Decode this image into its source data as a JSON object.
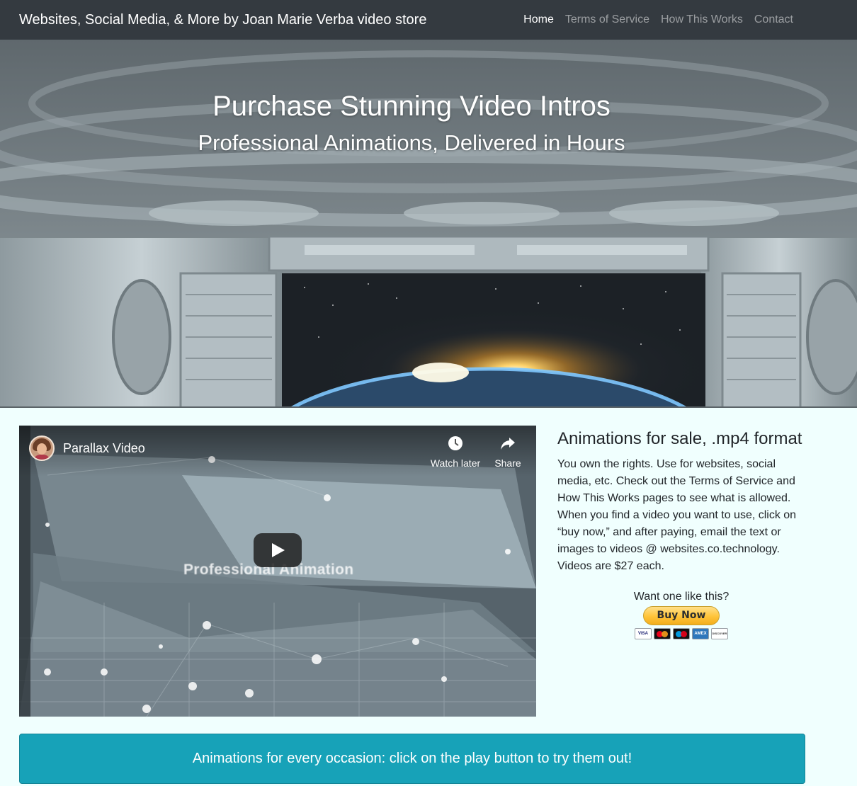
{
  "navbar": {
    "brand": "Websites, Social Media, & More by Joan Marie Verba video store",
    "links": [
      {
        "label": "Home"
      },
      {
        "label": "Terms of Service"
      },
      {
        "label": "How This Works"
      },
      {
        "label": "Contact"
      }
    ]
  },
  "hero": {
    "title": "Purchase Stunning Video Intros",
    "subtitle": "Professional Animations, Delivered in Hours"
  },
  "video": {
    "title": "Parallax Video",
    "watch_later": "Watch later",
    "share": "Share",
    "overlay_text": "Professional Animation"
  },
  "side": {
    "heading": "Animations for sale, .mp4 format",
    "body": "You own the rights. Use for websites, social media, etc. Check out the Terms of Service and How This Works pages to see what is allowed. When you find a video you want to use, click on “buy now,” and after paying, email the text or images to videos @ websites.co.technology. Videos are $27 each.",
    "want_text": "Want one like this?",
    "buy_label": "Buy Now",
    "cards": [
      "VISA",
      "Mastercard",
      "Maestro",
      "AMEX",
      "DISCOVER"
    ]
  },
  "alert": {
    "text": "Animations for every occasion: click on the play button to try them out!"
  },
  "colors": {
    "navbar": "#343a40",
    "page_background": "#f0fffe",
    "alert": "#17a2b8",
    "paypal_button": "#ffc439"
  }
}
